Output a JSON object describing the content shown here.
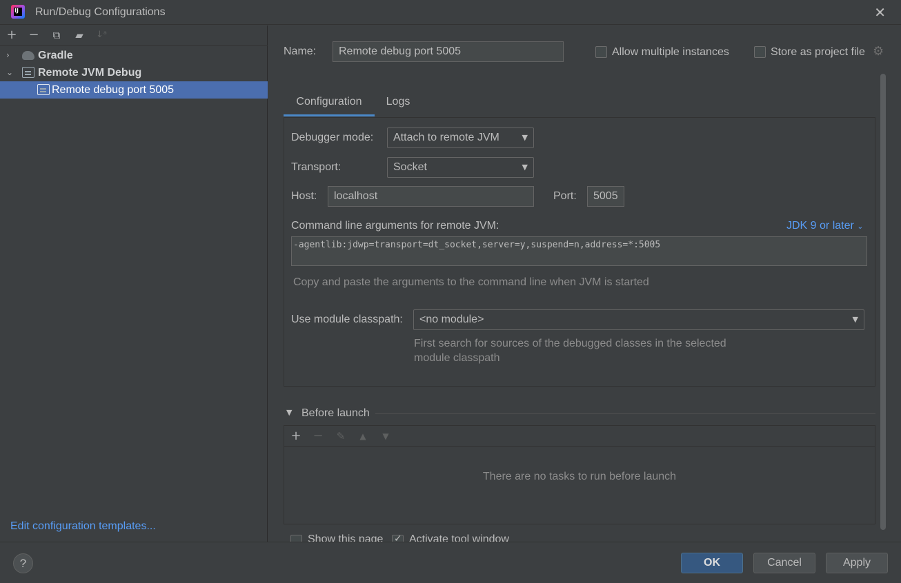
{
  "window": {
    "title": "Run/Debug Configurations"
  },
  "left": {
    "tree": [
      {
        "label": "Gradle",
        "expanded": false,
        "icon": "gradle-icon"
      },
      {
        "label": "Remote JVM Debug",
        "expanded": true,
        "icon": "jvm-debug-icon"
      },
      {
        "label": "Remote debug port 5005",
        "selected": true,
        "icon": "jvm-debug-icon"
      }
    ],
    "edit_templates_link": "Edit configuration templates..."
  },
  "form": {
    "name_label": "Name:",
    "name_value": "Remote debug port 5005",
    "allow_multiple_label": "Allow multiple instances",
    "allow_multiple_checked": false,
    "store_project_label": "Store as project file",
    "store_project_checked": false,
    "tabs": [
      "Configuration",
      "Logs"
    ],
    "active_tab": "Configuration",
    "debugger_mode_label": "Debugger mode:",
    "debugger_mode_value": "Attach to remote JVM",
    "transport_label": "Transport:",
    "transport_value": "Socket",
    "host_label": "Host:",
    "host_value": "localhost",
    "port_label": "Port:",
    "port_value": "5005",
    "cmdline_label": "Command line arguments for remote JVM:",
    "jdk_link": "JDK 9 or later",
    "cmdline_value": "-agentlib:jdwp=transport=dt_socket,server=y,suspend=n,address=*:5005",
    "cmdline_hint": "Copy and paste the arguments to the command line when JVM is started",
    "module_label": "Use module classpath:",
    "module_value": "<no module>",
    "module_hint_1": "First search for sources of the debugged classes in the selected",
    "module_hint_2": "module classpath",
    "before_launch_label": "Before launch",
    "no_tasks_text": "There are no tasks to run before launch",
    "show_page_label": "Show this page",
    "show_page_checked": false,
    "activate_tool_label": "Activate tool window",
    "activate_tool_checked": true
  },
  "buttons": {
    "ok": "OK",
    "cancel": "Cancel",
    "apply": "Apply",
    "help": "?"
  },
  "colors": {
    "background": "#3c3f41",
    "selection": "#4b6eaf",
    "link": "#589df6",
    "primary": "#365880"
  }
}
